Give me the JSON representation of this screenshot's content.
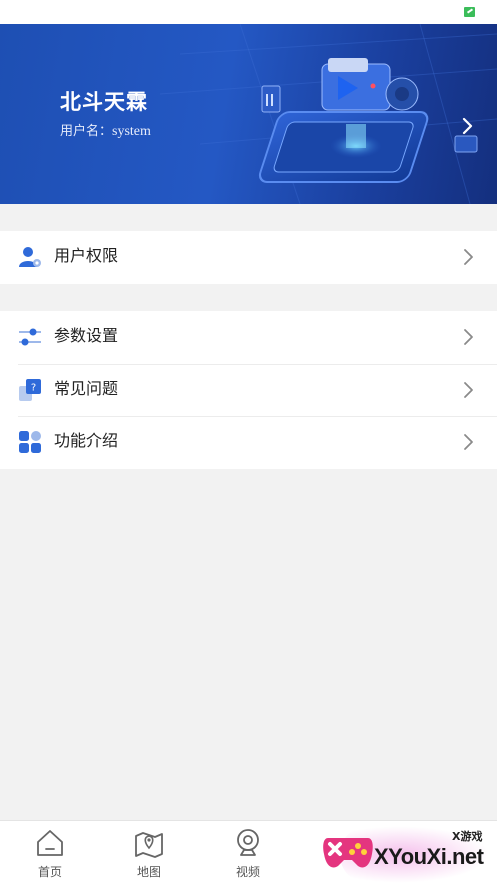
{
  "header": {
    "user_name": "北斗天霖",
    "account_label": "用户名：",
    "account_value": "system"
  },
  "menu_group_1": [
    {
      "label": "用户权限",
      "icon": "user-permission-icon"
    }
  ],
  "menu_group_2": [
    {
      "label": "参数设置",
      "icon": "sliders-icon"
    },
    {
      "label": "常见问题",
      "icon": "faq-icon"
    },
    {
      "label": "功能介绍",
      "icon": "grid-icon"
    }
  ],
  "tabbar": {
    "items": [
      {
        "label": "首页",
        "icon": "home-icon"
      },
      {
        "label": "地图",
        "icon": "map-icon"
      },
      {
        "label": "视频",
        "icon": "camera-icon"
      },
      {
        "label": "",
        "icon": "unknown-icon"
      },
      {
        "label": "",
        "icon": "unknown-icon"
      }
    ]
  },
  "watermark": {
    "text": "XYouXi.net",
    "small_text": "X游戏"
  },
  "colors": {
    "banner": "#2458c4",
    "icon_blue": "#2f6ad9",
    "background": "#f2f2f2"
  }
}
